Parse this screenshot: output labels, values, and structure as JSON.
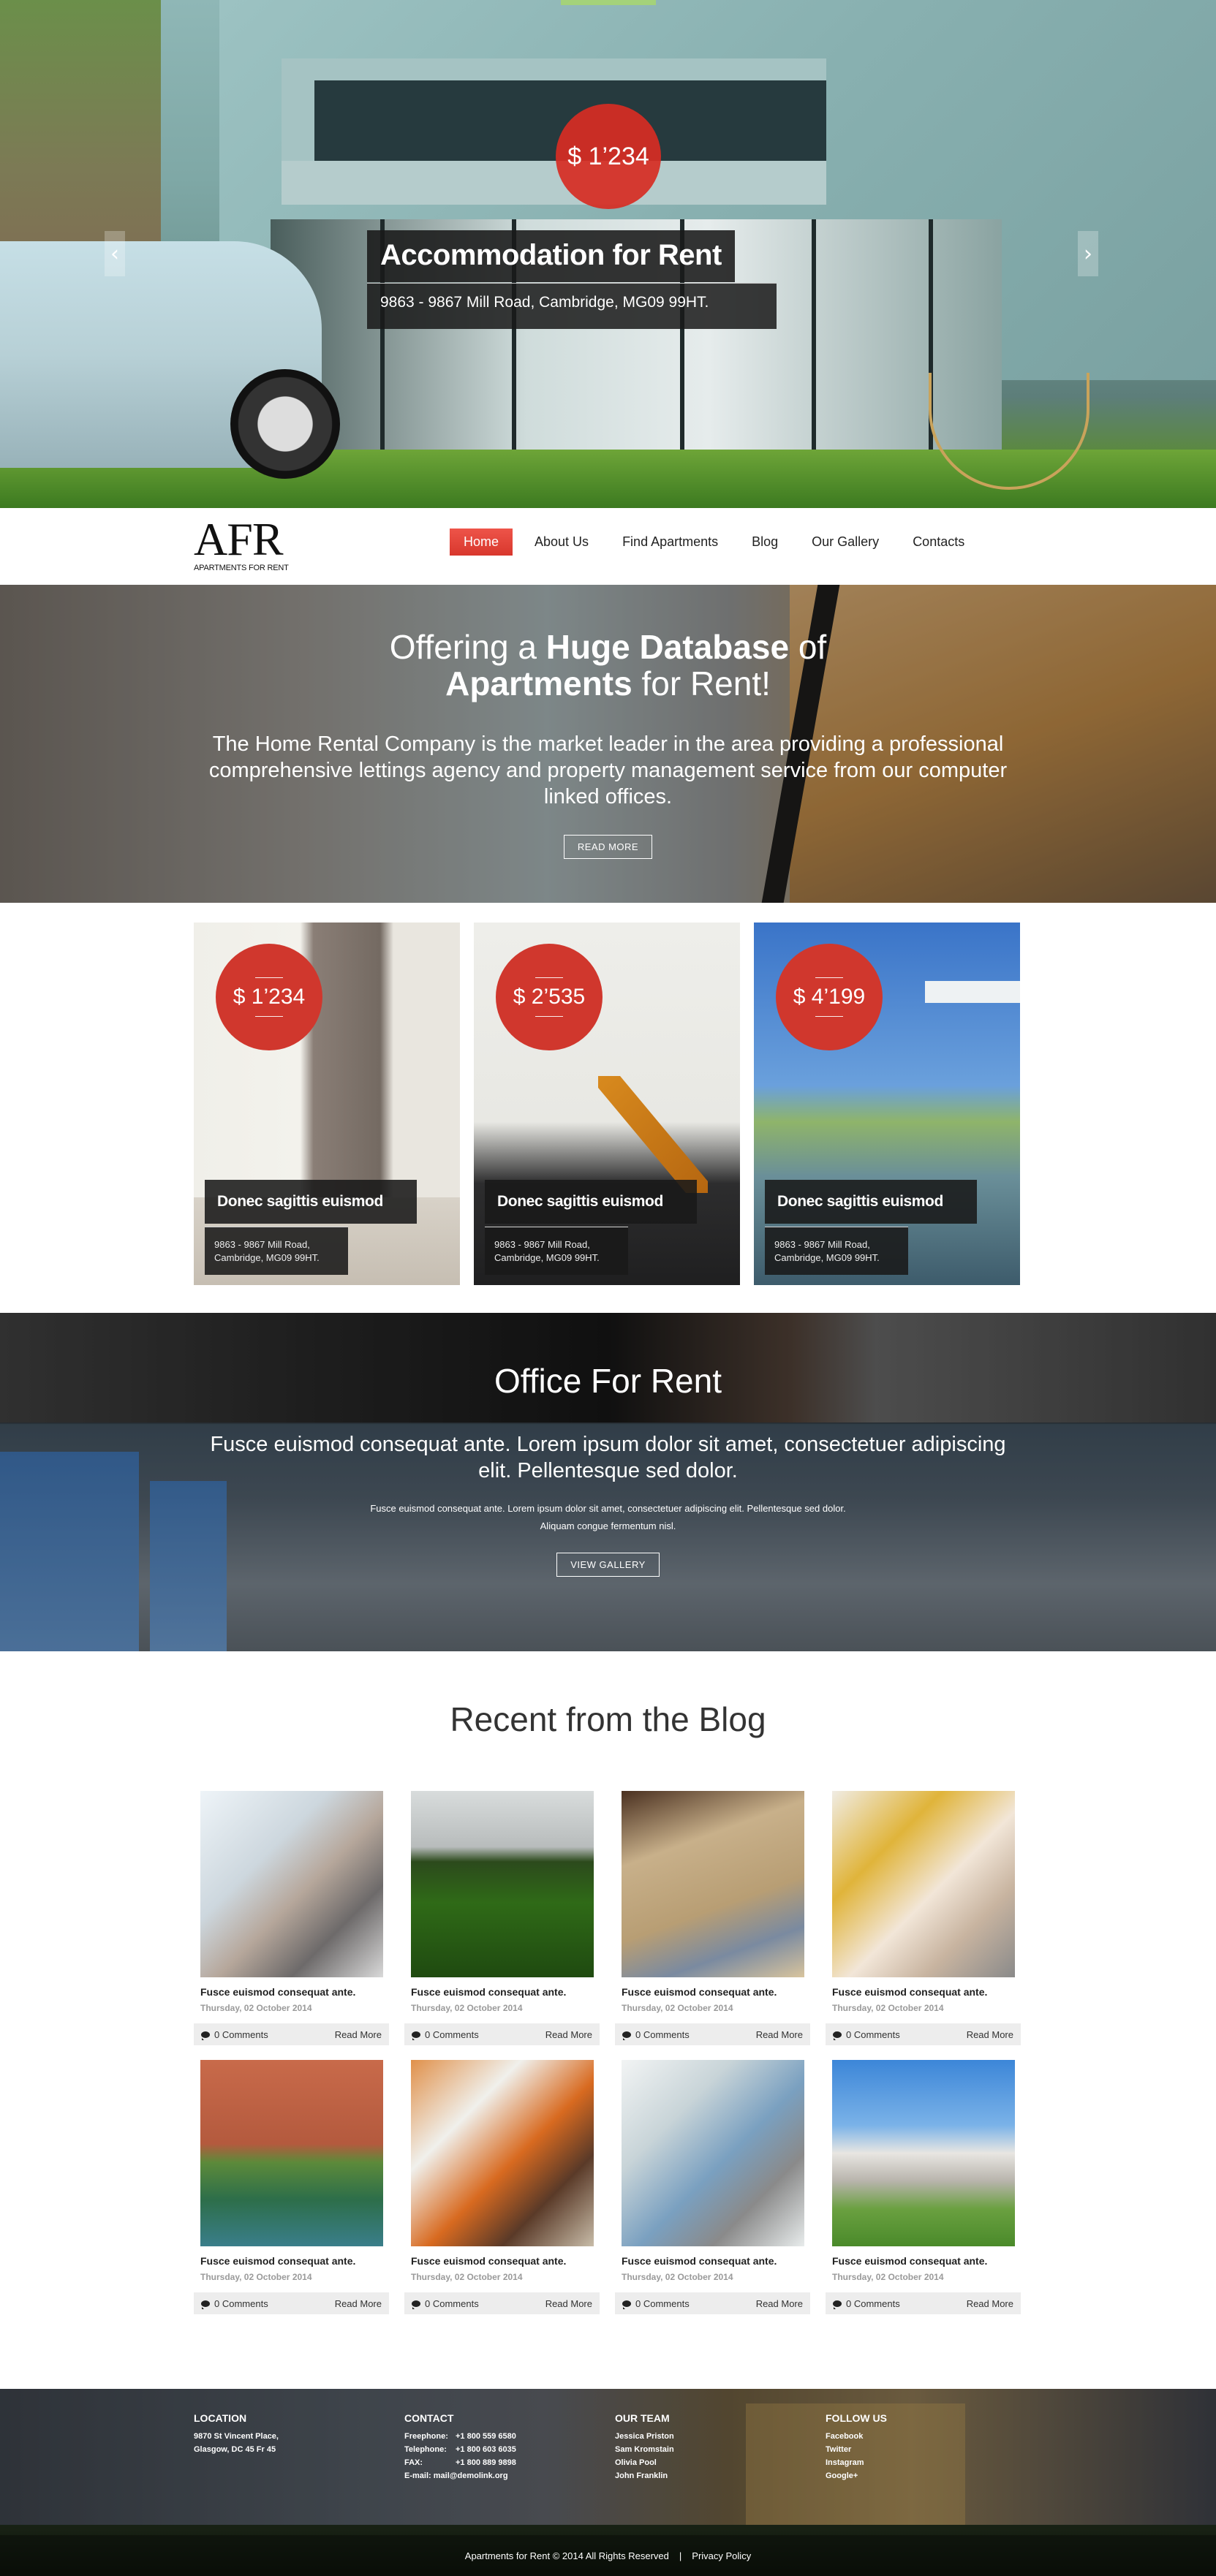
{
  "hero": {
    "price": "$ 1’234",
    "title": "Accommodation for Rent",
    "address": "9863 - 9867 Mill Road, Cambridge, MG09 99HT.",
    "prev_icon": "‹",
    "next_icon": "›"
  },
  "header": {
    "logo_mark": "AFR",
    "logo_tagline": "APARTMENTS FOR RENT",
    "nav": [
      {
        "label": "Home",
        "active": true
      },
      {
        "label": "About Us"
      },
      {
        "label": "Find Apartments"
      },
      {
        "label": "Blog"
      },
      {
        "label": "Our Gallery"
      },
      {
        "label": "Contacts"
      }
    ]
  },
  "offer": {
    "title_pre": "Offering a ",
    "title_bold1": "Huge Database",
    "title_mid": " of",
    "title_bold2": "Apartments",
    "title_post": " for Rent!",
    "text": "The Home Rental Company is the market leader in the area providing a professional comprehensive lettings agency and property management service from our computer linked offices.",
    "button": "READ MORE"
  },
  "listings": [
    {
      "price": "$ 1’234",
      "title": "Donec sagittis euismod",
      "address_line1": "9863 - 9867 Mill Road,",
      "address_line2": "Cambridge, MG09 99HT."
    },
    {
      "price": "$ 2’535",
      "title": "Donec sagittis euismod",
      "address_line1": "9863 - 9867 Mill Road,",
      "address_line2": "Cambridge, MG09 99HT."
    },
    {
      "price": "$ 4’199",
      "title": "Donec sagittis euismod",
      "address_line1": "9863 - 9867 Mill Road,",
      "address_line2": "Cambridge, MG09 99HT."
    }
  ],
  "office": {
    "title": "Office For Rent",
    "lead": "Fusce euismod consequat ante. Lorem ipsum dolor sit amet, consectetuer adipiscing elit. Pellentesque sed dolor.",
    "small_line1": "Fusce euismod consequat ante. Lorem ipsum dolor sit amet, consectetuer adipiscing elit. Pellentesque sed dolor.",
    "small_line2": "Aliquam congue fermentum nisl.",
    "button": "VIEW GALLERY"
  },
  "blog": {
    "heading": "Recent from the Blog",
    "posts": [
      {
        "title": "Fusce euismod consequat ante.",
        "date": "Thursday, 02 October 2014",
        "comments": "0 Comments",
        "read_more": "Read More"
      },
      {
        "title": "Fusce euismod consequat ante.",
        "date": "Thursday, 02 October 2014",
        "comments": "0 Comments",
        "read_more": "Read More"
      },
      {
        "title": "Fusce euismod consequat ante.",
        "date": "Thursday, 02 October 2014",
        "comments": "0 Comments",
        "read_more": "Read More"
      },
      {
        "title": "Fusce euismod consequat ante.",
        "date": "Thursday, 02 October 2014",
        "comments": "0 Comments",
        "read_more": "Read More"
      },
      {
        "title": "Fusce euismod consequat ante.",
        "date": "Thursday, 02 October 2014",
        "comments": "0 Comments",
        "read_more": "Read More"
      },
      {
        "title": "Fusce euismod consequat ante.",
        "date": "Thursday, 02 October 2014",
        "comments": "0 Comments",
        "read_more": "Read More"
      },
      {
        "title": "Fusce euismod consequat ante.",
        "date": "Thursday, 02 October 2014",
        "comments": "0 Comments",
        "read_more": "Read More"
      },
      {
        "title": "Fusce euismod consequat ante.",
        "date": "Thursday, 02 October 2014",
        "comments": "0 Comments",
        "read_more": "Read More"
      }
    ]
  },
  "footer": {
    "location": {
      "heading": "LOCATION",
      "line1": "9870 St Vincent Place,",
      "line2": "Glasgow, DC 45 Fr 45"
    },
    "contact": {
      "heading": "CONTACT",
      "rows": [
        {
          "label": "Freephone:",
          "value": "+1 800 559 6580"
        },
        {
          "label": "Telephone:",
          "value": "+1 800 603 6035"
        },
        {
          "label": "FAX:",
          "value": "+1 800 889 9898"
        }
      ],
      "email_label": "E-mail:",
      "email": "mail@demolink.org"
    },
    "team": {
      "heading": "OUR TEAM",
      "members": [
        "Jessica Priston",
        "Sam Kromstain",
        "Olivia Pool",
        "John Franklin"
      ]
    },
    "follow": {
      "heading": "FOLLOW US",
      "links": [
        "Facebook",
        "Twitter",
        "Instagram",
        "Google+"
      ]
    },
    "copyright": "Apartments for Rent © 2014 All Rights Reserved",
    "separator": "|",
    "privacy": "Privacy Policy"
  },
  "colors": {
    "accent": "#d8372d",
    "dark_overlay": "#191919",
    "blog_bar": "#ededed"
  }
}
